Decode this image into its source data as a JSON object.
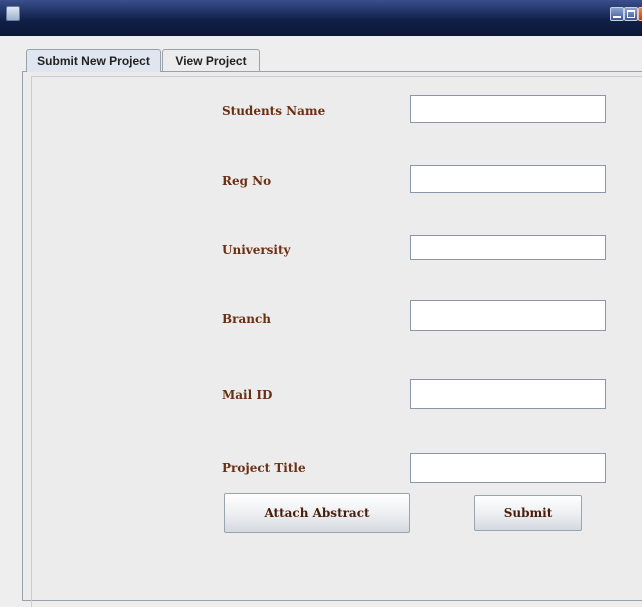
{
  "window": {
    "controls": [
      "minimize-icon",
      "maximize-icon",
      "close-icon"
    ]
  },
  "tabs": [
    {
      "label": "Submit New Project",
      "active": true
    },
    {
      "label": "View Project",
      "active": false
    }
  ],
  "form": {
    "fields": [
      {
        "label": "Students Name",
        "value": ""
      },
      {
        "label": "Reg No",
        "value": ""
      },
      {
        "label": "University",
        "value": ""
      },
      {
        "label": "Branch",
        "value": ""
      },
      {
        "label": "Mail ID",
        "value": ""
      },
      {
        "label": "Project Title",
        "value": ""
      }
    ],
    "attach_label": "Attach Abstract",
    "submit_label": "Submit"
  },
  "colors": {
    "label_text": "#6b2f12",
    "title_bar": "#11204a",
    "active_tab": "#dfe6ef"
  }
}
